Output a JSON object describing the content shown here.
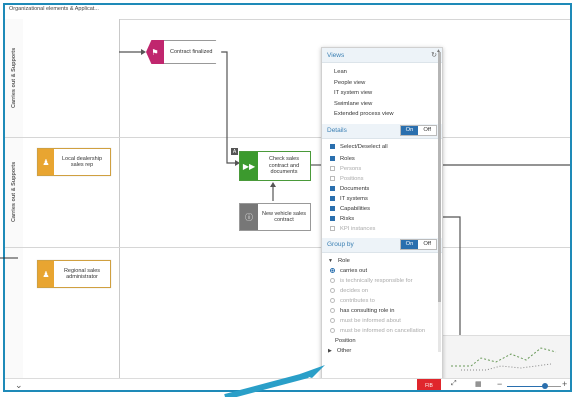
{
  "header": {
    "column_title": "Organizational elements & Applicat..."
  },
  "lanes": [
    {
      "label": "Carries out & Supports"
    },
    {
      "label": "Carries out & Supports"
    },
    {
      "label": ""
    }
  ],
  "roles": [
    {
      "label": "Local dealership sales rep"
    },
    {
      "label": "Regional sales administrator"
    }
  ],
  "diagram": {
    "event_label": "Contract finalized",
    "function_label": "Check sales contract and documents",
    "info_label": "New vehicle sales contract",
    "marker_label": "A"
  },
  "panel": {
    "views_title": "Views",
    "views": [
      "Lean",
      "People view",
      "IT system view",
      "Swimlane view",
      "Extended process view"
    ],
    "details_title": "Details",
    "on_label": "On",
    "off_label": "Off",
    "details": [
      {
        "label": "Select/Deselect all",
        "checked": true,
        "enabled": true
      },
      {
        "label": "Roles",
        "checked": true,
        "enabled": true
      },
      {
        "label": "Persons",
        "checked": false,
        "enabled": false
      },
      {
        "label": "Positions",
        "checked": false,
        "enabled": false
      },
      {
        "label": "Documents",
        "checked": true,
        "enabled": true
      },
      {
        "label": "IT systems",
        "checked": true,
        "enabled": true
      },
      {
        "label": "Capabilities",
        "checked": true,
        "enabled": true
      },
      {
        "label": "Risks",
        "checked": true,
        "enabled": true
      },
      {
        "label": "KPI instances",
        "checked": false,
        "enabled": false
      }
    ],
    "groupby_title": "Group by",
    "group_role": "Role",
    "group_options": [
      {
        "label": "carries out",
        "selected": true,
        "enabled": true
      },
      {
        "label": "is technically responsible for",
        "selected": false,
        "enabled": false
      },
      {
        "label": "decides on",
        "selected": false,
        "enabled": false
      },
      {
        "label": "contributes to",
        "selected": false,
        "enabled": false
      },
      {
        "label": "has consulting role in",
        "selected": false,
        "enabled": true
      },
      {
        "label": "must be informed about",
        "selected": false,
        "enabled": false
      },
      {
        "label": "must be informed on cancellation",
        "selected": false,
        "enabled": false
      }
    ],
    "group_position": "Position",
    "group_other": "Other"
  },
  "toolbar": {
    "red_button_label": "FIB",
    "zoom_level": 0.7
  },
  "colors": {
    "frame": "#1e8ab8",
    "accent": "#2a6fae",
    "event": "#c0266e",
    "function": "#3c9a2e",
    "role": "#e8a531"
  }
}
